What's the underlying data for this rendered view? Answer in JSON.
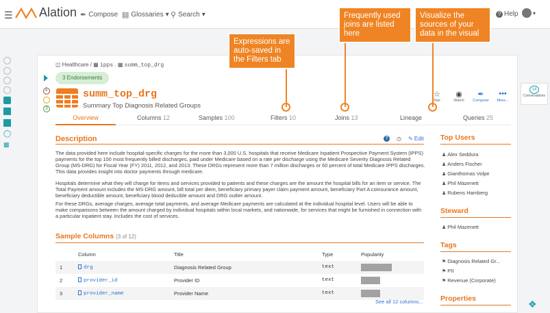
{
  "nav": {
    "app_name": "Alation",
    "compose": "Compose",
    "glossaries": "Glossaries",
    "search": "Search",
    "help": "Help"
  },
  "breadcrumb": {
    "source": "Healthcare",
    "schema": "ipps",
    "table": "summ_top_drg"
  },
  "endorsements": "3 Endorsements",
  "object": {
    "title": "summ_top_drg",
    "subtitle": "Summary Top Diagnosis Related Groups"
  },
  "status_badge": "3",
  "actions": [
    "Star",
    "Watch",
    "Compose",
    "More..."
  ],
  "tabs": [
    {
      "label": "Overview",
      "count": ""
    },
    {
      "label": "Columns",
      "count": "12"
    },
    {
      "label": "Samples",
      "count": "100"
    },
    {
      "label": "Filters",
      "count": "10"
    },
    {
      "label": "Joins",
      "count": "13"
    },
    {
      "label": "Lineage",
      "count": ""
    },
    {
      "label": "Queries",
      "count": "25"
    }
  ],
  "description": {
    "heading": "Description",
    "edit": "Edit",
    "paragraphs": [
      "The data provided here include hospital-specific charges for the more than 3,000 U.S. hospitals that receive Medicare Inpatient Prospective Payment System (IPPS) payments for the top 100 most frequently billed discharges, paid under Medicare based on a rate per discharge using the Medicare Severity Diagnosis Related Group (MS-DRG) for Fiscal Year (FY) 2011, 2012, and 2013. These DRGs represent more than 7 million discharges or 60 percent of total Medicare IPPS discharges. This data provides insight into doctor payments through medicare.",
      "Hospitals determine what they will charge for items and services provided to patients and these charges are the amount the hospital bills for an item or service. The Total Payment amount includes the MS-DRG amount, bill total per diem, beneficiary primary payer claim payment amount, beneficiary Part A coinsurance amount, beneficiary deductible amount, beneficiary blood deducible amount and DRG outlier amount.",
      "For these DRGs, average charges, average total payments, and average Medicare payments are calculated at the individual hospital level. Users will be able to make comparisons between the amount charged by individual hospitals within local markets, and nationwide, for services that might be furnished in connection with a particular inpatient stay. Includes the cost of services."
    ]
  },
  "sample_columns": {
    "heading": "Sample Columns",
    "count_text": "(3 of 12)",
    "headers": [
      "Column",
      "Title",
      "Type",
      "Popularity"
    ],
    "rows": [
      {
        "n": "1",
        "column": "drg",
        "title": "Diagnosis Related Group",
        "type": "text",
        "popularity": 0.9
      },
      {
        "n": "2",
        "column": "provider_id",
        "title": "Provider ID",
        "type": "text",
        "popularity": 0.55
      },
      {
        "n": "3",
        "column": "provider_name",
        "title": "Provider Name",
        "type": "text",
        "popularity": 0.55
      }
    ],
    "see_all": "See all 12 columns..."
  },
  "sidebar": {
    "top_users_heading": "Top Users",
    "top_users": [
      "Alex Seddura",
      "Anders Fischer",
      "Gianthomas Volpe",
      "Phil Mazenett",
      "Rubens Hamberg"
    ],
    "steward_heading": "Steward",
    "steward": "Phil Mazenett",
    "tags_heading": "Tags",
    "tags": [
      "Diagnosis Related Gr...",
      "PII",
      "Revenue (Corporate)"
    ],
    "properties_heading": "Properties"
  },
  "conversations": {
    "count": "14",
    "label": "Conversations"
  },
  "callouts": {
    "filters": "Expressions are auto-saved in the Filters tab",
    "joins": "Frequently used joins are listed here",
    "lineage": "Visualize the sources of your data in the visual"
  },
  "colors": {
    "accent": "#e8761c",
    "callout": "#ef8424",
    "link": "#2f6fd3",
    "teal": "#1f9aa3"
  }
}
